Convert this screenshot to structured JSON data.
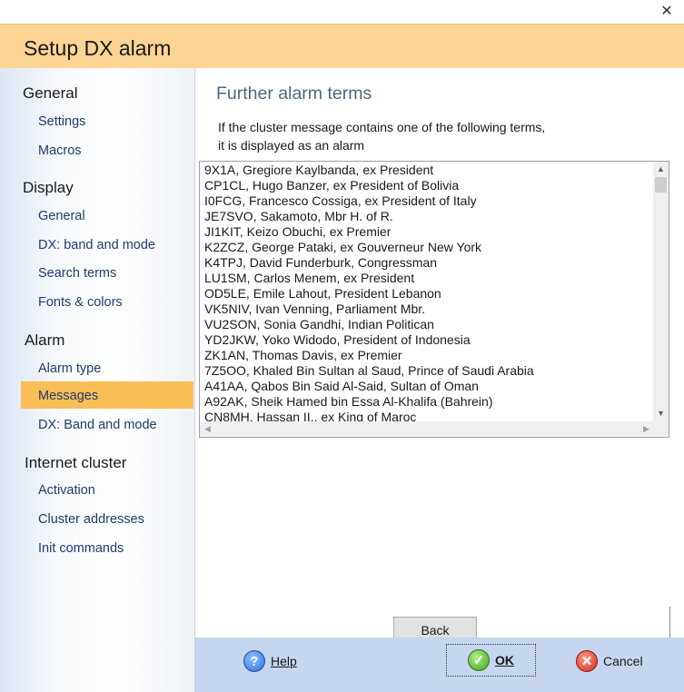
{
  "window": {
    "close_glyph": "✕"
  },
  "header": {
    "title": "Setup DX alarm"
  },
  "sidebar": {
    "groups": [
      {
        "label": "General",
        "items": [
          {
            "label": "Settings"
          },
          {
            "label": "Macros"
          }
        ]
      },
      {
        "label": "Display",
        "items": [
          {
            "label": "General"
          },
          {
            "label": "DX: band and mode"
          },
          {
            "label": "Search terms"
          },
          {
            "label": "Fonts & colors"
          }
        ]
      },
      {
        "label": "Alarm",
        "items": [
          {
            "label": "Alarm type"
          },
          {
            "label": "Messages",
            "selected": true
          },
          {
            "label": "DX: Band and mode"
          }
        ]
      },
      {
        "label": "Internet cluster",
        "items": [
          {
            "label": "Activation"
          },
          {
            "label": "Cluster addresses"
          },
          {
            "label": "Init commands"
          }
        ]
      }
    ],
    "selected_color": "#f9bf56"
  },
  "main": {
    "title": "Further alarm terms",
    "description_line1": "If the cluster message contains one of the following terms,",
    "description_line2": "it is displayed as an alarm",
    "terms": [
      "9X1A, Gregiore Kaylbanda, ex President",
      "CP1CL, Hugo Banzer, ex President of Bolivia",
      "I0FCG, Francesco Cossiga, ex President of Italy",
      "JE7SVO, Sakamoto, Mbr H. of  R.",
      "JI1KIT, Keizo Obuchi, ex Premier",
      "K2ZCZ, George Pataki, ex Gouverneur New York",
      "K4TPJ, David Funderburk, Congressman",
      "LU1SM, Carlos Menem, ex President",
      "OD5LE, Emile Lahout, President Lebanon",
      "VK5NIV, Ivan Venning, Parliament Mbr.",
      "VU2SON, Sonia Gandhi, Indian Politican",
      "YD2JKW, Yoko Widodo, President of Indonesia",
      "ZK1AN, Thomas Davis, ex Premier",
      "7Z5OO, Khaled  Bin Sultan al Saud, Prince of Saudi Arabia",
      "A41AA, Qabos Bin Said Al-Said, Sultan of Oman",
      "A92AK, Sheik Hamed bin Essa Al-Khalifa (Bahrein)",
      "CN8MH, Hassan II., ex King of Maroc"
    ]
  },
  "buttons": {
    "back": "Back",
    "help": "Help",
    "ok": "OK",
    "cancel": "Cancel"
  },
  "colors": {
    "header_bg": "#fcd493",
    "bottom_bar_bg": "#c6d6f0",
    "section_title": "#4d6680"
  }
}
